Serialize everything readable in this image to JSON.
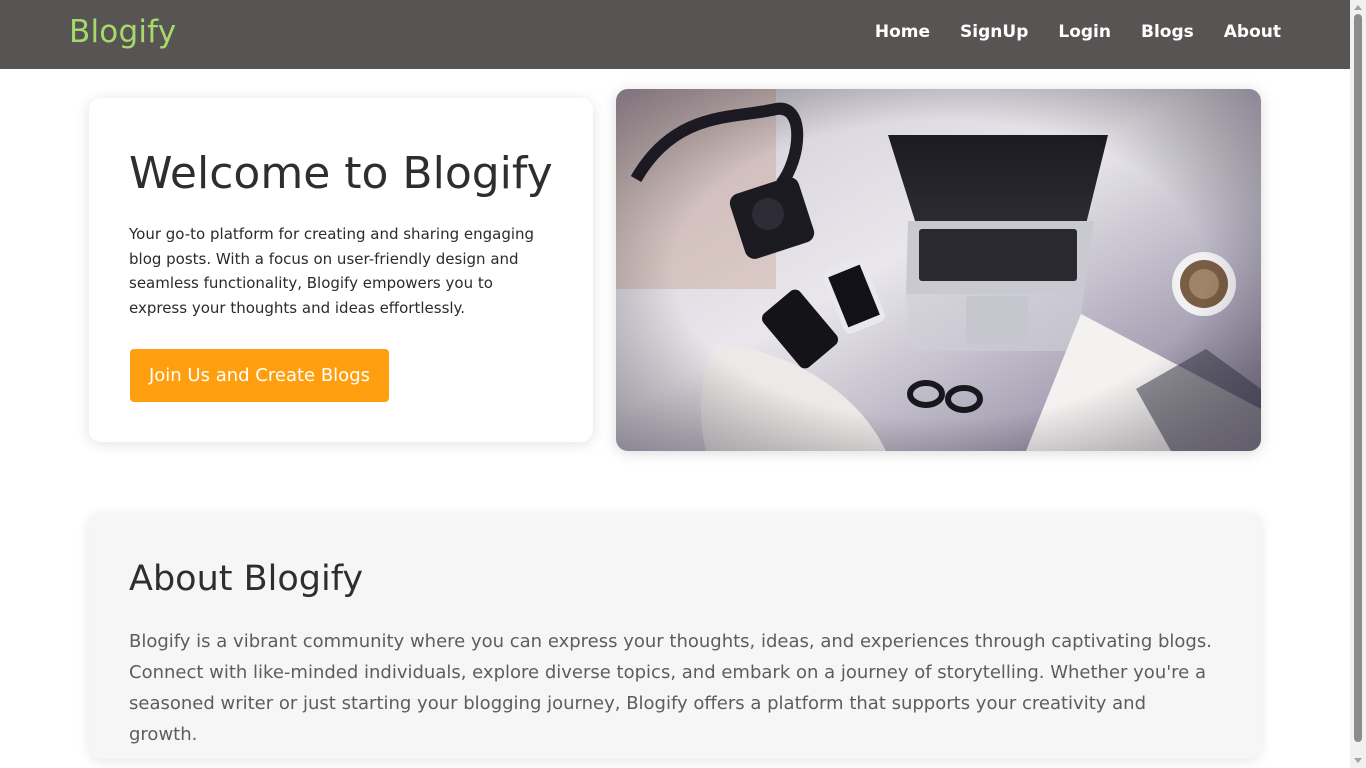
{
  "navbar": {
    "brand": "Blogify",
    "links": [
      "Home",
      "SignUp",
      "Login",
      "Blogs",
      "About"
    ]
  },
  "hero": {
    "title": "Welcome to Blogify",
    "description": "Your go-to platform for creating and sharing engaging blog posts. With a focus on user-friendly design and seamless functionality, Blogify empowers you to express your thoughts and ideas effortlessly.",
    "cta_label": "Join Us and Create Blogs",
    "image_alt": "laptop-camera-phones-coffee-flatlay"
  },
  "about": {
    "title": "About Blogify",
    "text": "Blogify is a vibrant community where you can express your thoughts, ideas, and experiences through captivating blogs. Connect with like-minded individuals, explore diverse topics, and embark on a journey of storytelling. Whether you're a seasoned writer or just starting your blogging journey, Blogify offers a platform that supports your creativity and growth."
  },
  "colors": {
    "navbar_bg": "#575453",
    "brand": "#a6d96a",
    "cta": "#ff9f0f",
    "about_bg": "#f6f6f6"
  }
}
